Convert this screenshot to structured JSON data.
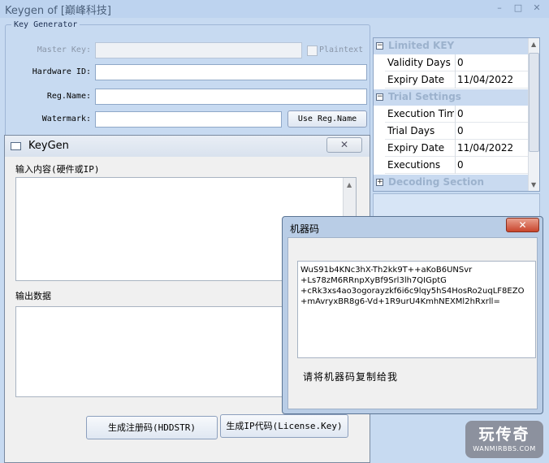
{
  "main_window": {
    "title": "Keygen of [巅峰科技]",
    "minimize_glyph": "–",
    "maximize_glyph": "□",
    "close_glyph": "✕",
    "group_label": "Key Generator",
    "fields": {
      "master_key_label": "Master Key:",
      "master_key_value": "",
      "plaintext_label": "Plaintext",
      "hardware_id_label": "Hardware ID:",
      "hardware_id_value": "",
      "reg_name_label": "Reg.Name:",
      "reg_name_value": "",
      "watermark_label": "Watermark:",
      "watermark_value": ""
    },
    "use_reg_name_button": "Use Reg.Name",
    "property_grid": {
      "categories": [
        {
          "name": "Limited KEY",
          "expander": "−",
          "rows": [
            {
              "name": "Validity Days",
              "value": "0"
            },
            {
              "name": "Expiry Date",
              "value": "11/04/2022"
            }
          ]
        },
        {
          "name": "Trial Settings",
          "expander": "−",
          "rows": [
            {
              "name": "Execution Time",
              "value": "0"
            },
            {
              "name": "Trial Days",
              "value": "0"
            },
            {
              "name": "Expiry Date",
              "value": "11/04/2022"
            },
            {
              "name": "Executions",
              "value": "0"
            }
          ]
        },
        {
          "name": "Decoding Section",
          "expander": "+",
          "rows": []
        }
      ]
    }
  },
  "keygen_window": {
    "title": "KeyGen",
    "close_glyph": "✕",
    "input_label": "输入内容(硬件或IP)",
    "input_value": "",
    "output_label": "输出数据",
    "output_value": "",
    "generate_reg_button": "生成注册码(HDDSTR)",
    "generate_ip_button": "生成IP代码(License.Key)"
  },
  "machine_code_dialog": {
    "title": "机器码",
    "close_glyph": "✕",
    "code_lines": [
      "WuS91b4KNc3hX-Th2kk9T++aKoB6UNSvr",
      "+Ls78zM6RRnpXyBf9Srl3lh7QIGptG",
      "+cRk3xs4ao3ogorayzkf6i6c9lqy5hS4HosRo2uqLF8EZO",
      "+mAvryxBR8g6-Vd+1R9urU4KmhNEXMl2hRxrll="
    ],
    "hint": "请将机器码复制给我"
  },
  "watermark": {
    "brand": "玩传奇",
    "url": "WANMIRBBS.COM"
  }
}
